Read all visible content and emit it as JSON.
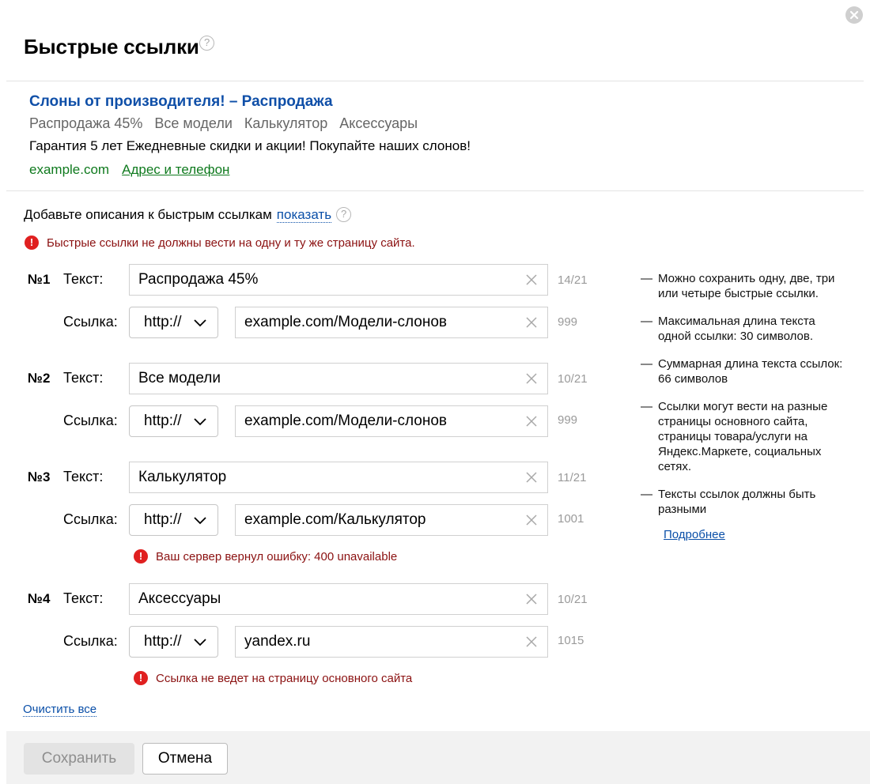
{
  "dialog": {
    "title": "Быстрые ссылки",
    "help_glyph": "?"
  },
  "preview": {
    "title": "Слоны от производителя! – Распродажа",
    "sitelinks": [
      "Распродажа 45%",
      "Все модели",
      "Калькулятор",
      "Аксессуары"
    ],
    "description": "Гарантия 5 лет Ежедневные скидки и акции! Покупайте наших слонов!",
    "domain": "example.com",
    "address_link": "Адрес и телефон"
  },
  "descriptions": {
    "text": "Добавьте описания к быстрым ссылкам",
    "show_link": "показать"
  },
  "global_error": "Быстрые ссылки не должны вести на одну и ту же страницу сайта.",
  "labels": {
    "text": "Текст:",
    "link": "Ссылка:"
  },
  "links": [
    {
      "num": "№1",
      "text": "Распродажа 45%",
      "text_counter": "14/21",
      "protocol": "http://",
      "url": "example.com/Модели-слонов",
      "url_counter": "999",
      "error": ""
    },
    {
      "num": "№2",
      "text": "Все модели",
      "text_counter": "10/21",
      "protocol": "http://",
      "url": "example.com/Модели-слонов",
      "url_counter": "999",
      "error": ""
    },
    {
      "num": "№3",
      "text": "Калькулятор",
      "text_counter": "11/21",
      "protocol": "http://",
      "url": "example.com/Калькулятор",
      "url_counter": "1001",
      "error": "Ваш сервер вернул ошибку: 400 unavailable"
    },
    {
      "num": "№4",
      "text": "Аксессуары",
      "text_counter": "10/21",
      "protocol": "http://",
      "url": "yandex.ru",
      "url_counter": "1015",
      "error": "Ссылка не ведет на страницу основного сайта"
    }
  ],
  "hints": [
    "Можно сохранить одну, две, три или четыре быстрые ссылки.",
    "Максимальная длина текста одной ссылки: 30 символов.",
    "Суммарная длина текста ссылок: 66 символов",
    "Ссылки могут вести на разные страницы основного сайта, страницы товара/услуги на Яндекс.Маркете, социальных сетях.",
    "Тексты ссылок должны быть разными"
  ],
  "hint_dash": "—",
  "more_link": "Подробнее",
  "clear_all": "Очистить все",
  "footer": {
    "save": "Сохранить",
    "cancel": "Отмена"
  },
  "colors": {
    "link_blue": "#0a4fa8",
    "error_red": "#e02020",
    "domain_green": "#0f7a1e"
  }
}
